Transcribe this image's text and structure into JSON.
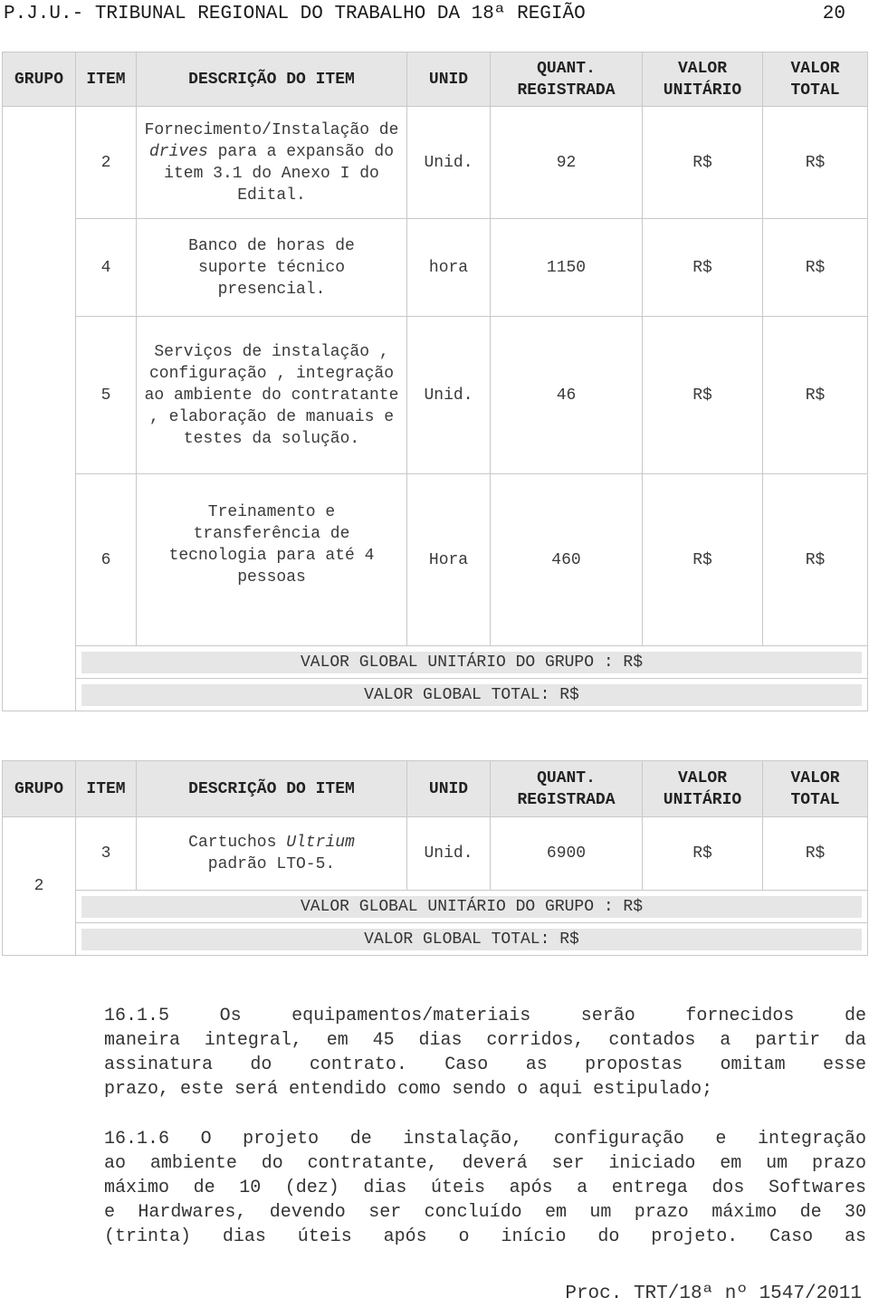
{
  "page_header": {
    "title": "P.J.U.- TRIBUNAL REGIONAL DO TRABALHO DA 18ª REGIÃO",
    "page_number": "20"
  },
  "columns": [
    "GRUPO",
    "ITEM",
    "DESCRIÇÃO DO ITEM",
    "UNID",
    "QUANT. REGISTRADA",
    "VALOR UNITÁRIO",
    "VALOR TOTAL"
  ],
  "column_lines": {
    "quant": [
      "QUANT.",
      "REGISTRADA"
    ],
    "valor_unit": [
      "VALOR",
      "UNITÁRIO"
    ],
    "valor_total": [
      "VALOR",
      "TOTAL"
    ]
  },
  "table1": {
    "grupo": "",
    "rows": [
      {
        "item": "2",
        "desc_pre": "Fornecimento/Instalação de ",
        "desc_em": "drives",
        "desc_post": " para a expansão do item 3.1 do Anexo I do Edital.",
        "unid": "Unid.",
        "quant": "92",
        "valor_unit": "R$",
        "valor_total": "R$"
      },
      {
        "item": "4",
        "desc_pre": "Banco de horas de suporte técnico presencial.",
        "desc_em": "",
        "desc_post": "",
        "unid": "hora",
        "quant": "1150",
        "valor_unit": "R$",
        "valor_total": "R$"
      },
      {
        "item": "5",
        "desc_pre": "Serviços de instalação , configuração , integração ao ambiente do contratante , elaboração de manuais e testes da solução.",
        "desc_em": "",
        "desc_post": "",
        "unid": "Unid.",
        "quant": "46",
        "valor_unit": "R$",
        "valor_total": "R$"
      },
      {
        "item": "6",
        "desc_pre": "Treinamento e transferência de tecnologia para até 4 pessoas",
        "desc_em": "",
        "desc_post": "",
        "unid": "Hora",
        "quant": "460",
        "valor_unit": "R$",
        "valor_total": "R$"
      }
    ],
    "summary_unit": "VALOR GLOBAL UNITÁRIO DO GRUPO : R$",
    "summary_total": "VALOR GLOBAL TOTAL: R$"
  },
  "table2": {
    "grupo": "2",
    "rows": [
      {
        "item": "3",
        "desc_pre": "Cartuchos ",
        "desc_em": "Ultrium",
        "desc_post": " padrão LTO-5.",
        "unid": "Unid.",
        "quant": "6900",
        "valor_unit": "R$",
        "valor_total": "R$"
      }
    ],
    "summary_unit": "VALOR GLOBAL UNITÁRIO DO GRUPO : R$",
    "summary_total": "VALOR GLOBAL TOTAL: R$"
  },
  "paragraphs": [
    {
      "lines": [
        "16.1.5 Os equipamentos/materiais serão fornecidos de",
        "maneira integral, em 45 dias corridos, contados a partir da",
        "assinatura do contrato. Caso as propostas omitam esse",
        "prazo, este será entendido como sendo o aqui estipulado;"
      ]
    },
    {
      "lines": [
        "16.1.6 O projeto de instalação, configuração e integração",
        "ao ambiente do contratante, deverá ser iniciado em um prazo",
        "máximo de 10 (dez) dias úteis após a entrega dos Softwares",
        "e Hardwares, devendo ser concluído em um prazo máximo de 30",
        "(trinta) dias úteis após o início do projeto. Caso as"
      ]
    }
  ],
  "footer": "Proc. TRT/18ª nº 1547/2011"
}
